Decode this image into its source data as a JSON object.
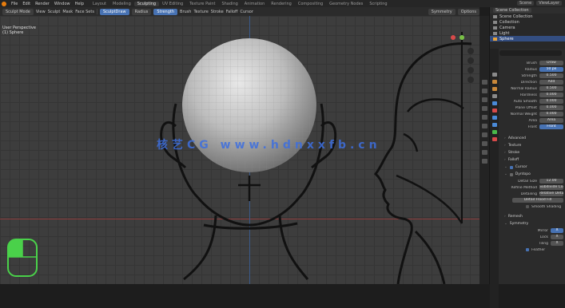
{
  "topbar": {
    "menu": [
      "File",
      "Edit",
      "Render",
      "Window",
      "Help"
    ],
    "tabs": [
      "Layout",
      "Modeling",
      "Sculpting",
      "UV Editing",
      "Texture Paint",
      "Shading",
      "Animation",
      "Rendering",
      "Compositing",
      "Geometry Nodes",
      "Scripting"
    ],
    "active_tab": "Sculpting",
    "right": [
      "Scene",
      "ViewLayer"
    ]
  },
  "viewport_header": {
    "mode": "Sculpt Mode",
    "items": [
      "View",
      "Sculpt",
      "Mask",
      "Face Sets"
    ],
    "brush": "SculptDraw",
    "radius": "Radius",
    "strength": "Strength",
    "tools": [
      "Brush",
      "Texture",
      "Stroke",
      "Falloff",
      "Cursor"
    ],
    "right": [
      "Symmetry",
      "Options"
    ]
  },
  "viewport_info": {
    "line1": "User Perspective",
    "line2": "(1) Sphere"
  },
  "watermark": "核艺CG www.hdnxxfb.cn",
  "outliner": {
    "header": [
      "Scene Collection"
    ],
    "rows": [
      {
        "label": "Scene Collection",
        "selected": false
      },
      {
        "label": "Collection",
        "selected": false
      },
      {
        "label": "Camera",
        "selected": false
      },
      {
        "label": "Light",
        "selected": false
      },
      {
        "label": "Sphere",
        "selected": true
      }
    ]
  },
  "properties": {
    "rows": [
      {
        "label": "Brush",
        "value": "Draw"
      },
      {
        "label": "Radius",
        "value": "50 px",
        "blue": true
      },
      {
        "label": "Strength",
        "value": "0.500"
      },
      {
        "label": "Direction",
        "value": "Add"
      },
      {
        "label": "Normal Radius",
        "value": "0.500"
      },
      {
        "label": "Hardness",
        "value": "0.000"
      },
      {
        "label": "Auto Smooth",
        "value": "0.000"
      },
      {
        "label": "Plane Offset",
        "value": "0.000"
      },
      {
        "label": "Normal Weight",
        "value": "0.000"
      },
      {
        "label": "Area",
        "value": "Area"
      },
      {
        "label": "Front",
        "value": "Front",
        "blue": true
      }
    ],
    "sections": [
      "Advanced",
      "Texture",
      "Stroke",
      "Falloff",
      "Cursor",
      "Dyntopo",
      "Remesh",
      "Symmetry"
    ],
    "dyntopo_rows": [
      {
        "label": "Detail Size",
        "value": "12.00"
      },
      {
        "label": "Refine Method",
        "value": "Subdivide Collapse"
      },
      {
        "label": "Detailing",
        "value": "Relative Detail"
      }
    ],
    "detail_flood": "Detail Flood Fill",
    "smooth_shading": "Smooth Shading",
    "symmetry_rows": [
      {
        "label": "Mirror",
        "value": "X"
      },
      {
        "label": "Lock",
        "value": "X"
      },
      {
        "label": "Tiling",
        "value": "X"
      }
    ],
    "feather": "Feather"
  }
}
